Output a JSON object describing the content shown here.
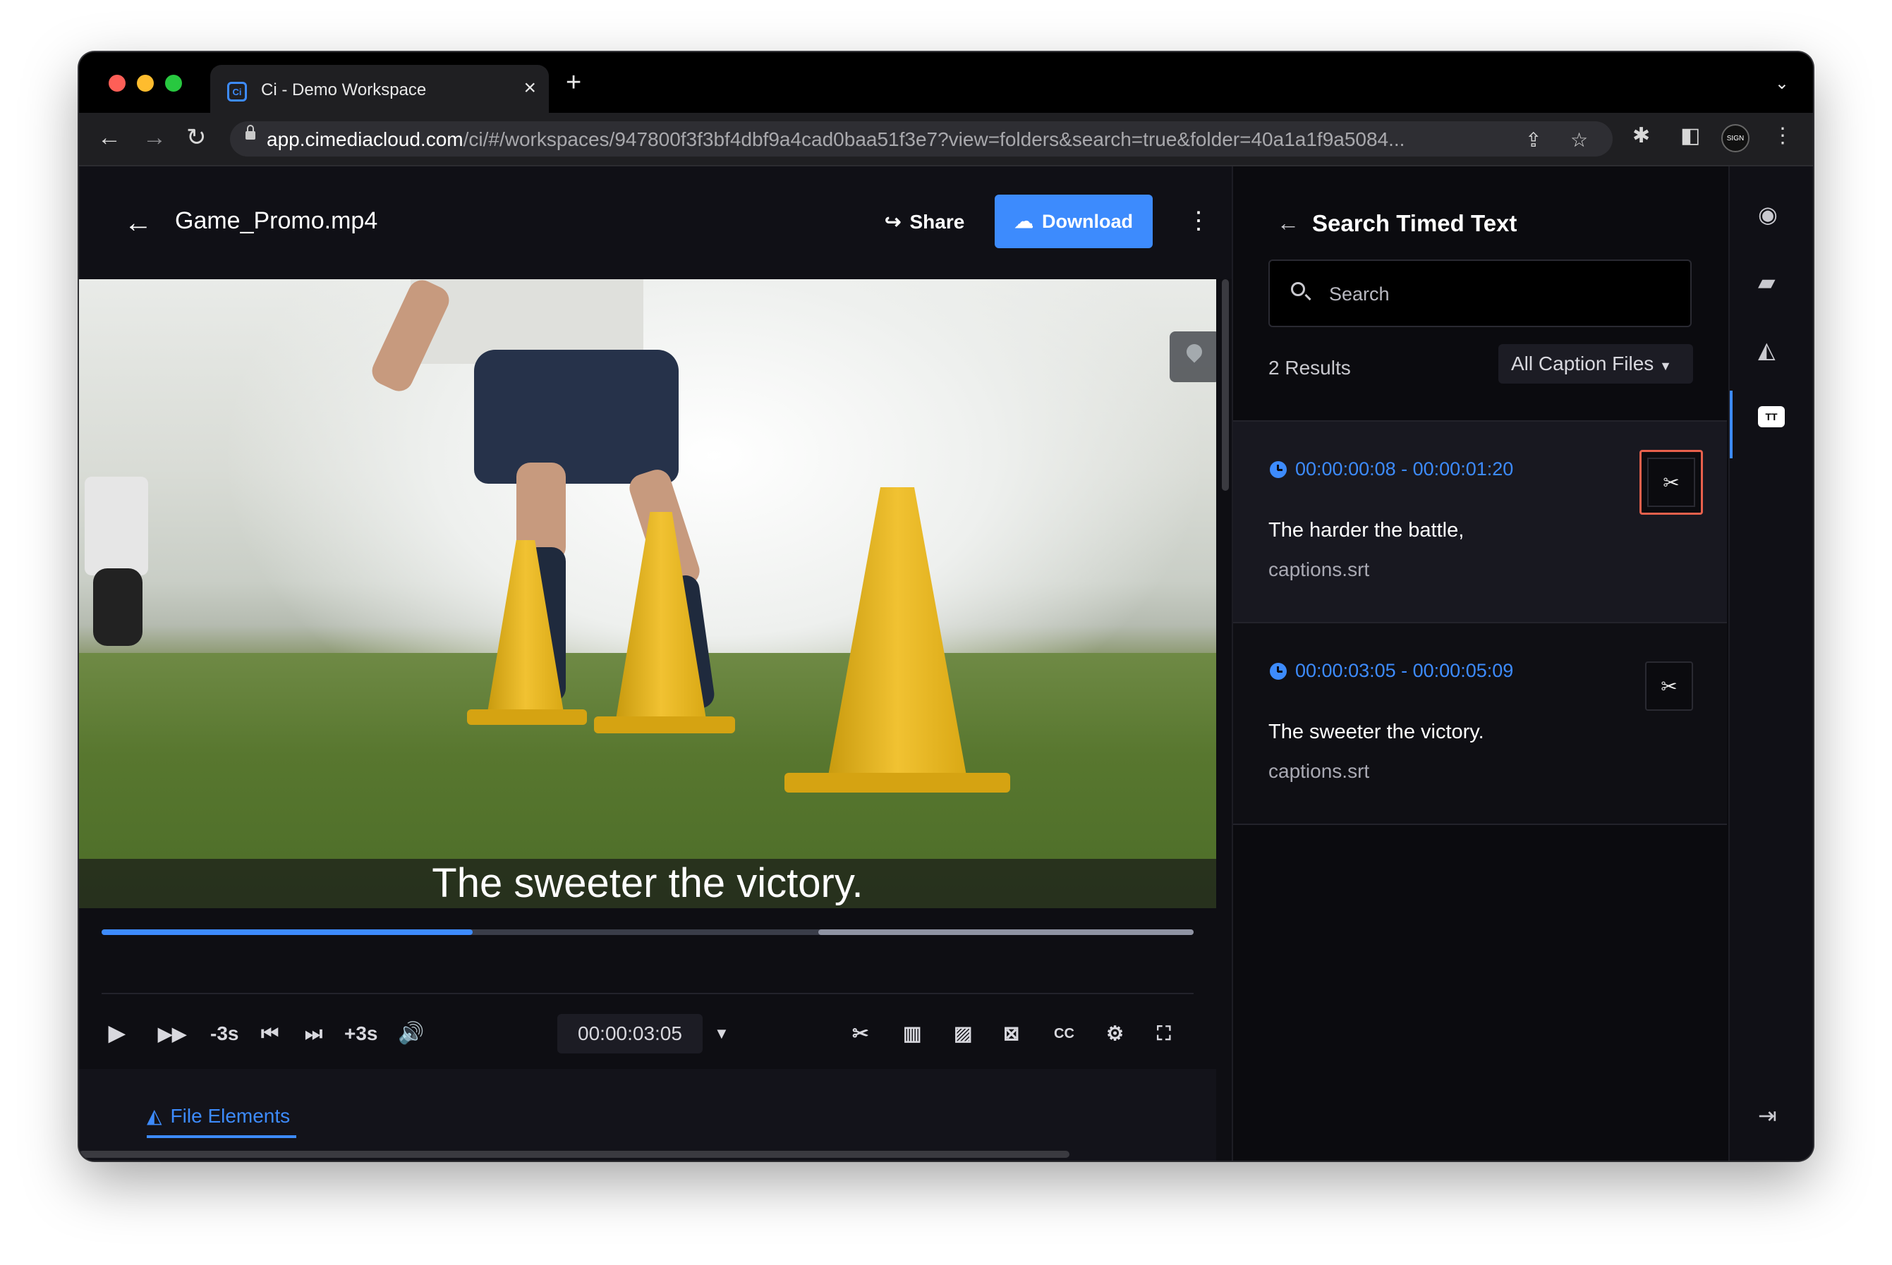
{
  "browser": {
    "tab_title": "Ci - Demo Workspace",
    "tab_icon_text": "Ci",
    "url_host": "app.cimediacloud.com",
    "url_path": "/ci/#/workspaces/947800f3f3bf4dbf9a4cad0baa51f3e7?view=folders&search=true&folder=40a1a1f9a5084...",
    "profile_text": "SIGN"
  },
  "header": {
    "filename": "Game_Promo.mp4",
    "share_label": "Share",
    "download_label": "Download"
  },
  "player": {
    "caption_text": "The sweeter the victory.",
    "progress_played": 0.34,
    "timecode": "00:00:03:05",
    "skip_back_label": "-3s",
    "skip_fwd_label": "+3s"
  },
  "bottom_tabs": {
    "file_elements_label": "File Elements"
  },
  "panel": {
    "title": "Search Timed Text",
    "search_placeholder": "Search",
    "results_count": "2 Results",
    "filter_label": "All Caption Files",
    "results": [
      {
        "time": "00:00:00:08 - 00:00:01:20",
        "text": "The harder the battle,",
        "file": "captions.srt"
      },
      {
        "time": "00:00:03:05 - 00:00:05:09",
        "text": "The sweeter the victory.",
        "file": "captions.srt"
      }
    ]
  },
  "rail": {
    "tt_label": "TT"
  },
  "colors": {
    "accent": "#3d8bfd",
    "highlight": "#e8604c"
  }
}
